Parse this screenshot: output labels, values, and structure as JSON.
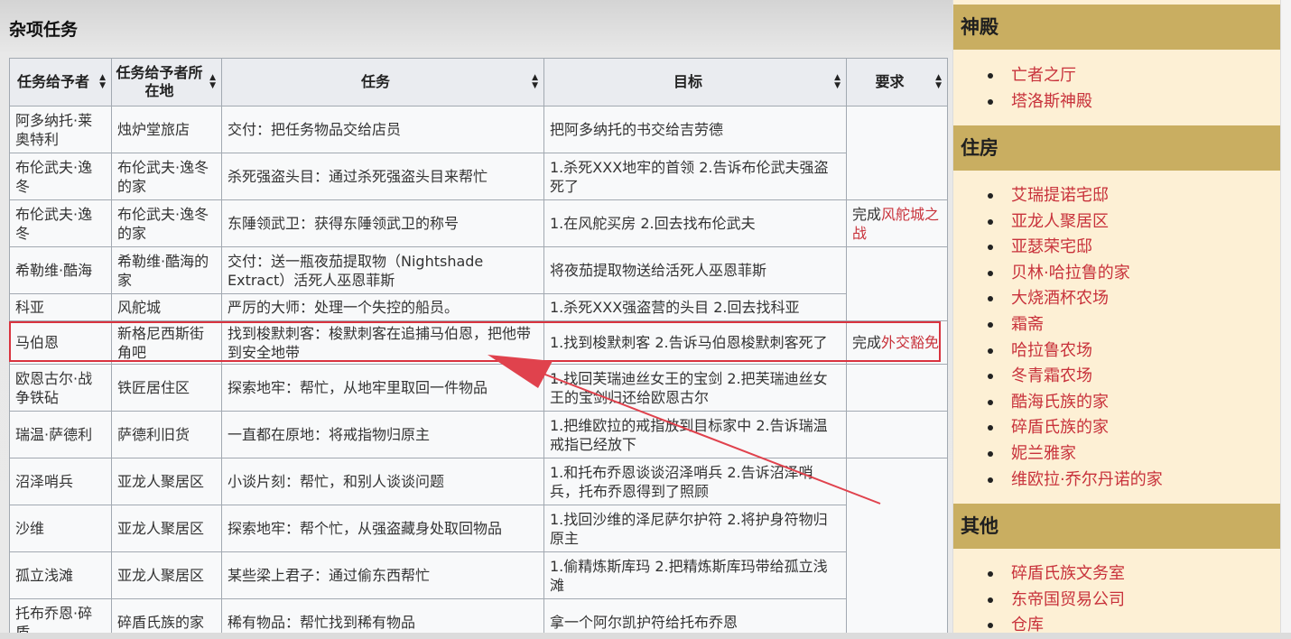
{
  "section_title": "杂项任务",
  "table": {
    "columns": [
      "任务给予者",
      "任务给予者所在地",
      "任务",
      "目标",
      "要求"
    ],
    "rows": [
      {
        "giver": "阿多纳托·莱奥特利",
        "location": "烛炉堂旅店",
        "quest": "交付：把任务物品交给店员",
        "goal": "把阿多纳托的书交给吉劳德",
        "req_prefix": "",
        "req_link": ""
      },
      {
        "giver": "布伦武夫·逸冬",
        "location": "布伦武夫·逸冬的家",
        "quest": "杀死强盗头目：通过杀死强盗头目来帮忙",
        "goal": "1.杀死XXX地牢的首领 2.告诉布伦武夫强盗死了",
        "req_prefix": "",
        "req_link": ""
      },
      {
        "giver": "布伦武夫·逸冬",
        "location": "布伦武夫·逸冬的家",
        "quest": "东陲领武卫：获得东陲领武卫的称号",
        "goal": "1.在风舵买房 2.回去找布伦武夫",
        "req_prefix": "完成",
        "req_link": "风舵城之战"
      },
      {
        "giver": "希勒维·酷海",
        "location": "希勒维·酷海的家",
        "quest": "交付：送一瓶夜茄提取物（Nightshade Extract）活死人巫恩菲斯",
        "goal": "将夜茄提取物送给活死人巫恩菲斯",
        "req_prefix": "",
        "req_link": ""
      },
      {
        "giver": "科亚",
        "location": "风舵城",
        "quest": "严厉的大师：处理一个失控的船员。",
        "goal": "1.杀死XXX强盗营的头目 2.回去找科亚",
        "req_prefix": "",
        "req_link": ""
      },
      {
        "giver": "马伯恩",
        "location": "新格尼西斯街角吧",
        "quest": "找到梭默刺客：梭默刺客在追捕马伯恩，把他带到安全地带",
        "goal": "1.找到梭默刺客 2.告诉马伯恩梭默刺客死了",
        "req_prefix": "完成",
        "req_link": "外交豁免"
      },
      {
        "giver": "欧恩古尔·战争铁砧",
        "location": "铁匠居住区",
        "quest": "探索地牢：帮忙，从地牢里取回一件物品",
        "goal": "1.找回芙瑞迪丝女王的宝剑 2.把芙瑞迪丝女王的宝剑归还给欧恩古尔",
        "req_prefix": "",
        "req_link": ""
      },
      {
        "giver": "瑞温·萨德利",
        "location": "萨德利旧货",
        "quest": "一直都在原地：将戒指物归原主",
        "goal": "1.把维欧拉的戒指放到目标家中 2.告诉瑞温戒指已经放下",
        "req_prefix": "",
        "req_link": ""
      },
      {
        "giver": "沼泽哨兵",
        "location": "亚龙人聚居区",
        "quest": "小谈片刻：帮忙，和别人谈谈问题",
        "goal": "1.和托布乔恩谈谈沼泽哨兵 2.告诉沼泽哨兵，托布乔恩得到了照顾",
        "req_prefix": "",
        "req_link": ""
      },
      {
        "giver": "沙维",
        "location": "亚龙人聚居区",
        "quest": "探索地牢：帮个忙，从强盗藏身处取回物品",
        "goal": "1.找回沙维的泽尼萨尔护符 2.将护身符物归原主",
        "req_prefix": "",
        "req_link": ""
      },
      {
        "giver": "孤立浅滩",
        "location": "亚龙人聚居区",
        "quest": "某些梁上君子：通过偷东西帮忙",
        "goal": "1.偷精炼斯库玛 2.把精炼斯库玛带给孤立浅滩",
        "req_prefix": "",
        "req_link": ""
      },
      {
        "giver": "托布乔恩·碎盾",
        "location": "碎盾氏族的家",
        "quest": "稀有物品：帮忙找到稀有物品",
        "goal": "拿一个阿尔凯护符给托布乔恩",
        "req_prefix": "",
        "req_link": ""
      }
    ]
  },
  "sidebar": {
    "sections": [
      {
        "title": "神殿",
        "items": [
          "亡者之厅",
          "塔洛斯神殿"
        ]
      },
      {
        "title": "住房",
        "items": [
          "艾瑞提诺宅邸",
          "亚龙人聚居区",
          "亚瑟荣宅邸",
          "贝林·哈拉鲁的家",
          "大烧酒杯农场",
          "霜斋",
          "哈拉鲁农场",
          "冬青霜农场",
          "酷海氏族的家",
          "碎盾氏族的家",
          "妮兰雅家",
          "维欧拉·乔尔丹诺的家"
        ]
      },
      {
        "title": "其他",
        "items": [
          "碎盾氏族文务室",
          "东帝国贸易公司",
          "仓库"
        ]
      }
    ]
  },
  "colors": {
    "annotation": "#d9333f",
    "link": "#c8323b",
    "sidebar_header": "#c9ae61",
    "sidebar_bg": "#fdf0d5"
  }
}
